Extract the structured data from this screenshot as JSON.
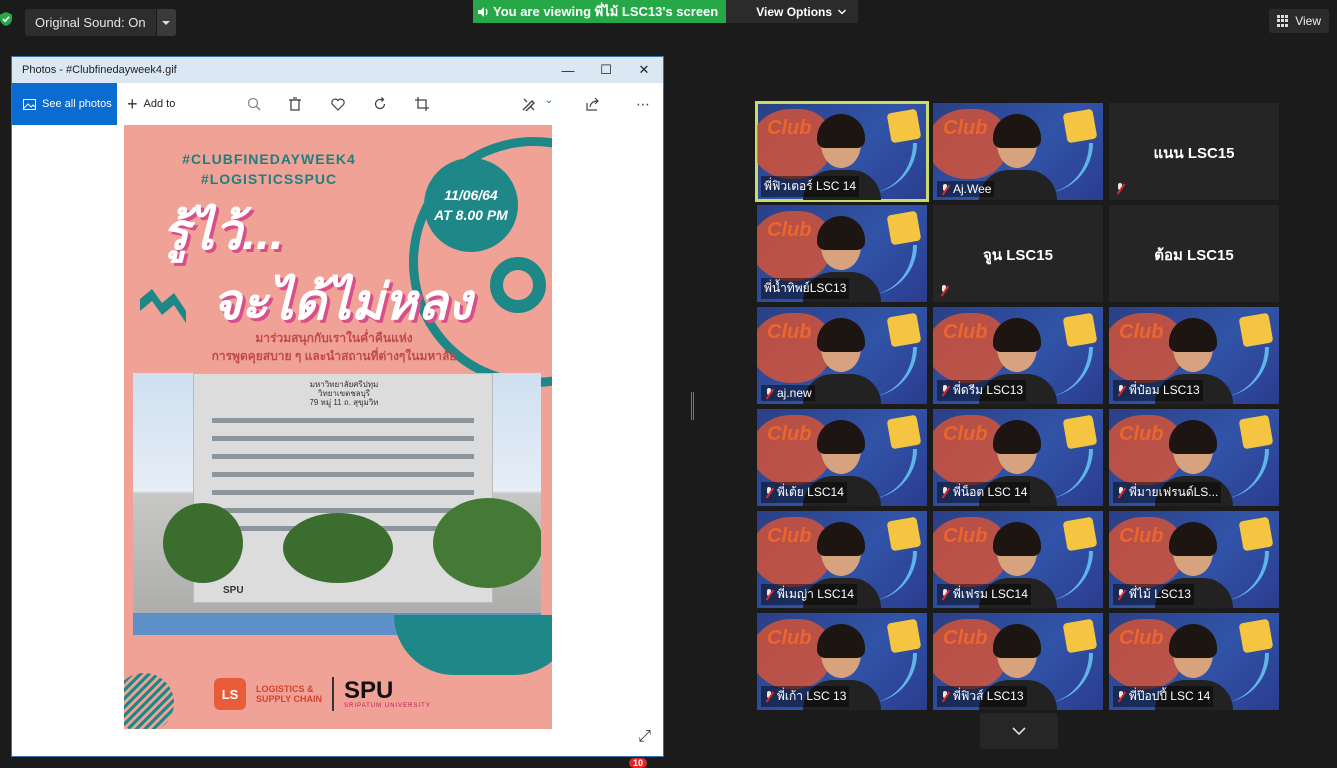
{
  "topbar": {
    "original_sound": "Original Sound: On",
    "viewing_banner": "You are viewing พี่ไม้ LSC13's screen",
    "view_options": "View Options",
    "view_button": "View"
  },
  "photos_window": {
    "title": "Photos - #Clubfinedayweek4.gif",
    "see_all": "See all photos",
    "add_to": "Add to",
    "icons": [
      "zoom-icon",
      "delete-icon",
      "heart-icon",
      "rotate-icon",
      "crop-icon",
      "edit-icon",
      "share-icon",
      "more-icon"
    ]
  },
  "poster": {
    "hashtag1": "#CLUBFINEDAYWEEK4",
    "hashtag2": "#LOGISTICSSPUC",
    "date": "11/06/64",
    "time": "AT 8.00 PM",
    "title_line1": "รู้ไว้...",
    "title_line2": "จะได้ไม่หลง",
    "desc_line1": "มาร่วมสนุกกับเราในค่ำคืนแห่ง",
    "desc_line2": "การพูดคุยสบาย ๆ และนำสถานที่ต่างๆในมหาลัย",
    "building_sign_line1": "มหาวิทยาลัยศรีปทุม",
    "building_sign_line2": "วิทยาเขตชลบุรี",
    "building_sign_line3": "79 หมู่ 11 ถ. สุขุมวิท",
    "ls_logo": "LS",
    "ls_text_line1": "LOGISTICS &",
    "ls_text_line2": "SUPPLY CHAIN",
    "spu": "SPU",
    "spu_sub": "SRIPATUM UNIVERSITY",
    "spu_ground": "SPU"
  },
  "participants": [
    {
      "name": "พี่ฟิวเตอร์ LSC 14",
      "video": true,
      "active": true,
      "muted": false
    },
    {
      "name": "Aj.Wee",
      "video": true,
      "active": false,
      "muted": true
    },
    {
      "name": "แนน LSC15",
      "video": false,
      "active": false,
      "muted": true
    },
    {
      "name": "พี่น้ำทิพย์LSC13",
      "video": true,
      "active": false,
      "muted": false
    },
    {
      "name": "จูน LSC15",
      "video": false,
      "active": false,
      "muted": true
    },
    {
      "name": "ต้อม LSC15",
      "video": false,
      "active": false,
      "muted": false
    },
    {
      "name": "aj.new",
      "video": true,
      "active": false,
      "muted": true
    },
    {
      "name": "พี่ดรีม LSC13",
      "video": true,
      "active": false,
      "muted": true
    },
    {
      "name": "พี่ป๋อม LSC13",
      "video": true,
      "active": false,
      "muted": true
    },
    {
      "name": "พี่เต้ย LSC14",
      "video": true,
      "active": false,
      "muted": true
    },
    {
      "name": "พี่น็อต LSC 14",
      "video": true,
      "active": false,
      "muted": true
    },
    {
      "name": "พี่มายเฟรนด์LS...",
      "video": true,
      "active": false,
      "muted": true
    },
    {
      "name": "พี่เมญ่า LSC14",
      "video": true,
      "active": false,
      "muted": true
    },
    {
      "name": "พี่เฟรม LSC14",
      "video": true,
      "active": false,
      "muted": true
    },
    {
      "name": "พี่ไม้ LSC13",
      "video": true,
      "active": false,
      "muted": true
    },
    {
      "name": "พี่เก้า LSC 13",
      "video": true,
      "active": false,
      "muted": true
    },
    {
      "name": "พี่ฟิวส์ LSC13",
      "video": true,
      "active": false,
      "muted": true
    },
    {
      "name": "พี่ป๊อปปี้ LSC 14",
      "video": true,
      "active": false,
      "muted": true
    }
  ],
  "tile_watermark": "Club",
  "bottombar": {
    "badge_count": "10"
  },
  "colors": {
    "banner_green": "#26a848",
    "active_speaker": "#c8dd68",
    "poster_bg": "#f0a297",
    "poster_teal": "#1d8887",
    "muted_red": "#e02828"
  }
}
